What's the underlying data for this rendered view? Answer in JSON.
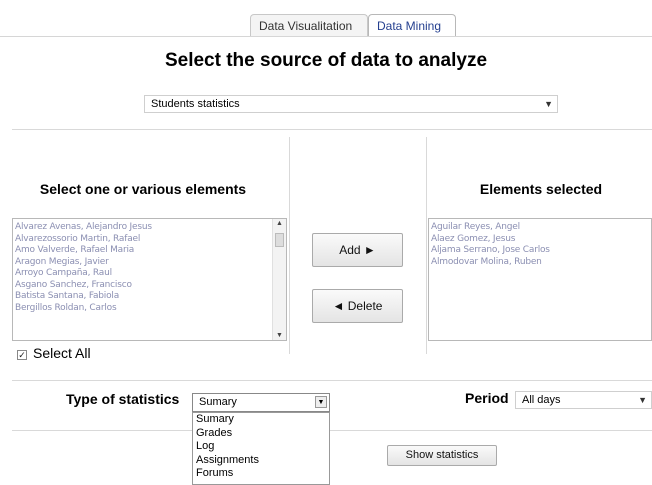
{
  "tabs": [
    {
      "label": "Data Visualitation"
    },
    {
      "label": "Data Mining"
    }
  ],
  "page_title": "Select the source of data to analyze",
  "source_select": {
    "value": "Students statistics"
  },
  "left_panel": {
    "label": "Select one or various elements",
    "items": [
      "Alvarez Avenas, Alejandro Jesus",
      "Alvarezossorio Martin, Rafael",
      "Amo Valverde, Rafael Maria",
      "Aragon Megias, Javier",
      "Arroyo Campaña, Raul",
      "Asgano Sanchez, Francisco",
      "Batista Santana, Fabiola",
      "Bergillos Roldan, Carlos"
    ],
    "select_all_label": "Select All"
  },
  "buttons": {
    "add": "Add ►",
    "delete": "◄ Delete",
    "show_statistics": "Show statistics"
  },
  "right_panel": {
    "label": "Elements selected",
    "items": [
      "Aguilar Reyes, Angel",
      "Alaez Gomez, Jesus",
      "Aljama Serrano, Jose Carlos",
      "Almodovar Molina, Ruben"
    ]
  },
  "statistics": {
    "type_label": "Type of statistics",
    "type_value": "Sumary",
    "type_options": [
      "Sumary",
      "Grades",
      "Log",
      "Assignments",
      "Forums"
    ],
    "period_label": "Period",
    "period_value": "All days"
  },
  "icons": {
    "dropdown": "chevron-down-icon",
    "checkbox": "check-icon"
  }
}
